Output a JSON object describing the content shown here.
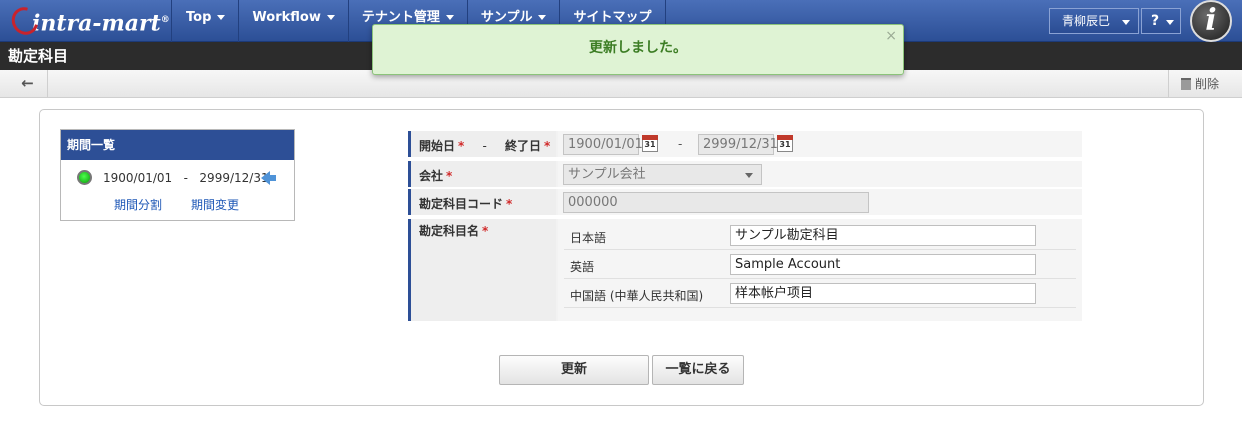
{
  "nav": {
    "logo": "intra-mart",
    "logo_reg": "®",
    "menu": [
      {
        "label": "Top",
        "name": "nav-top"
      },
      {
        "label": "Workflow",
        "name": "nav-workflow"
      },
      {
        "label": "テナント管理",
        "name": "nav-tenant-admin"
      },
      {
        "label": "サンプル",
        "name": "nav-sample"
      },
      {
        "label": "サイトマップ",
        "name": "nav-sitemap"
      }
    ],
    "user": "青柳辰巳",
    "help": "?",
    "info_badge": "i"
  },
  "page": {
    "title": "勘定科目"
  },
  "toolbar": {
    "back_icon": "←",
    "delete_label": "削除"
  },
  "toast": {
    "message": "更新しました。",
    "close": "×"
  },
  "period_list": {
    "title": "期間一覧",
    "range_start": "1900/01/01",
    "range_sep": "-",
    "range_end": "2999/12/31",
    "split_link": "期間分割",
    "change_link": "期間変更"
  },
  "form": {
    "start_label": "開始日",
    "end_label": "終了日",
    "label_sep": "-",
    "required_mark": "*",
    "start_value": "1900/01/01",
    "end_value": "2999/12/31",
    "date_sep": "-",
    "calendar_glyph": "31",
    "company_label": "会社",
    "company_value": "サンプル会社",
    "code_label": "勘定科目コード",
    "code_value": "000000",
    "name_label": "勘定科目名",
    "names": [
      {
        "lang": "日本語",
        "value": "サンプル勘定科目"
      },
      {
        "lang": "英語",
        "value": "Sample Account"
      },
      {
        "lang": "中国語 (中華人民共和国)",
        "value": "样本帐户项目"
      }
    ]
  },
  "buttons": {
    "update": "更新",
    "back_to_list": "一覧に戻る"
  },
  "colors": {
    "nav_blue": "#2c4f96",
    "toast_bg": "#dff3d4",
    "toast_text": "#3c7d24",
    "required": "#d12b2b",
    "link": "#1e57b6"
  }
}
